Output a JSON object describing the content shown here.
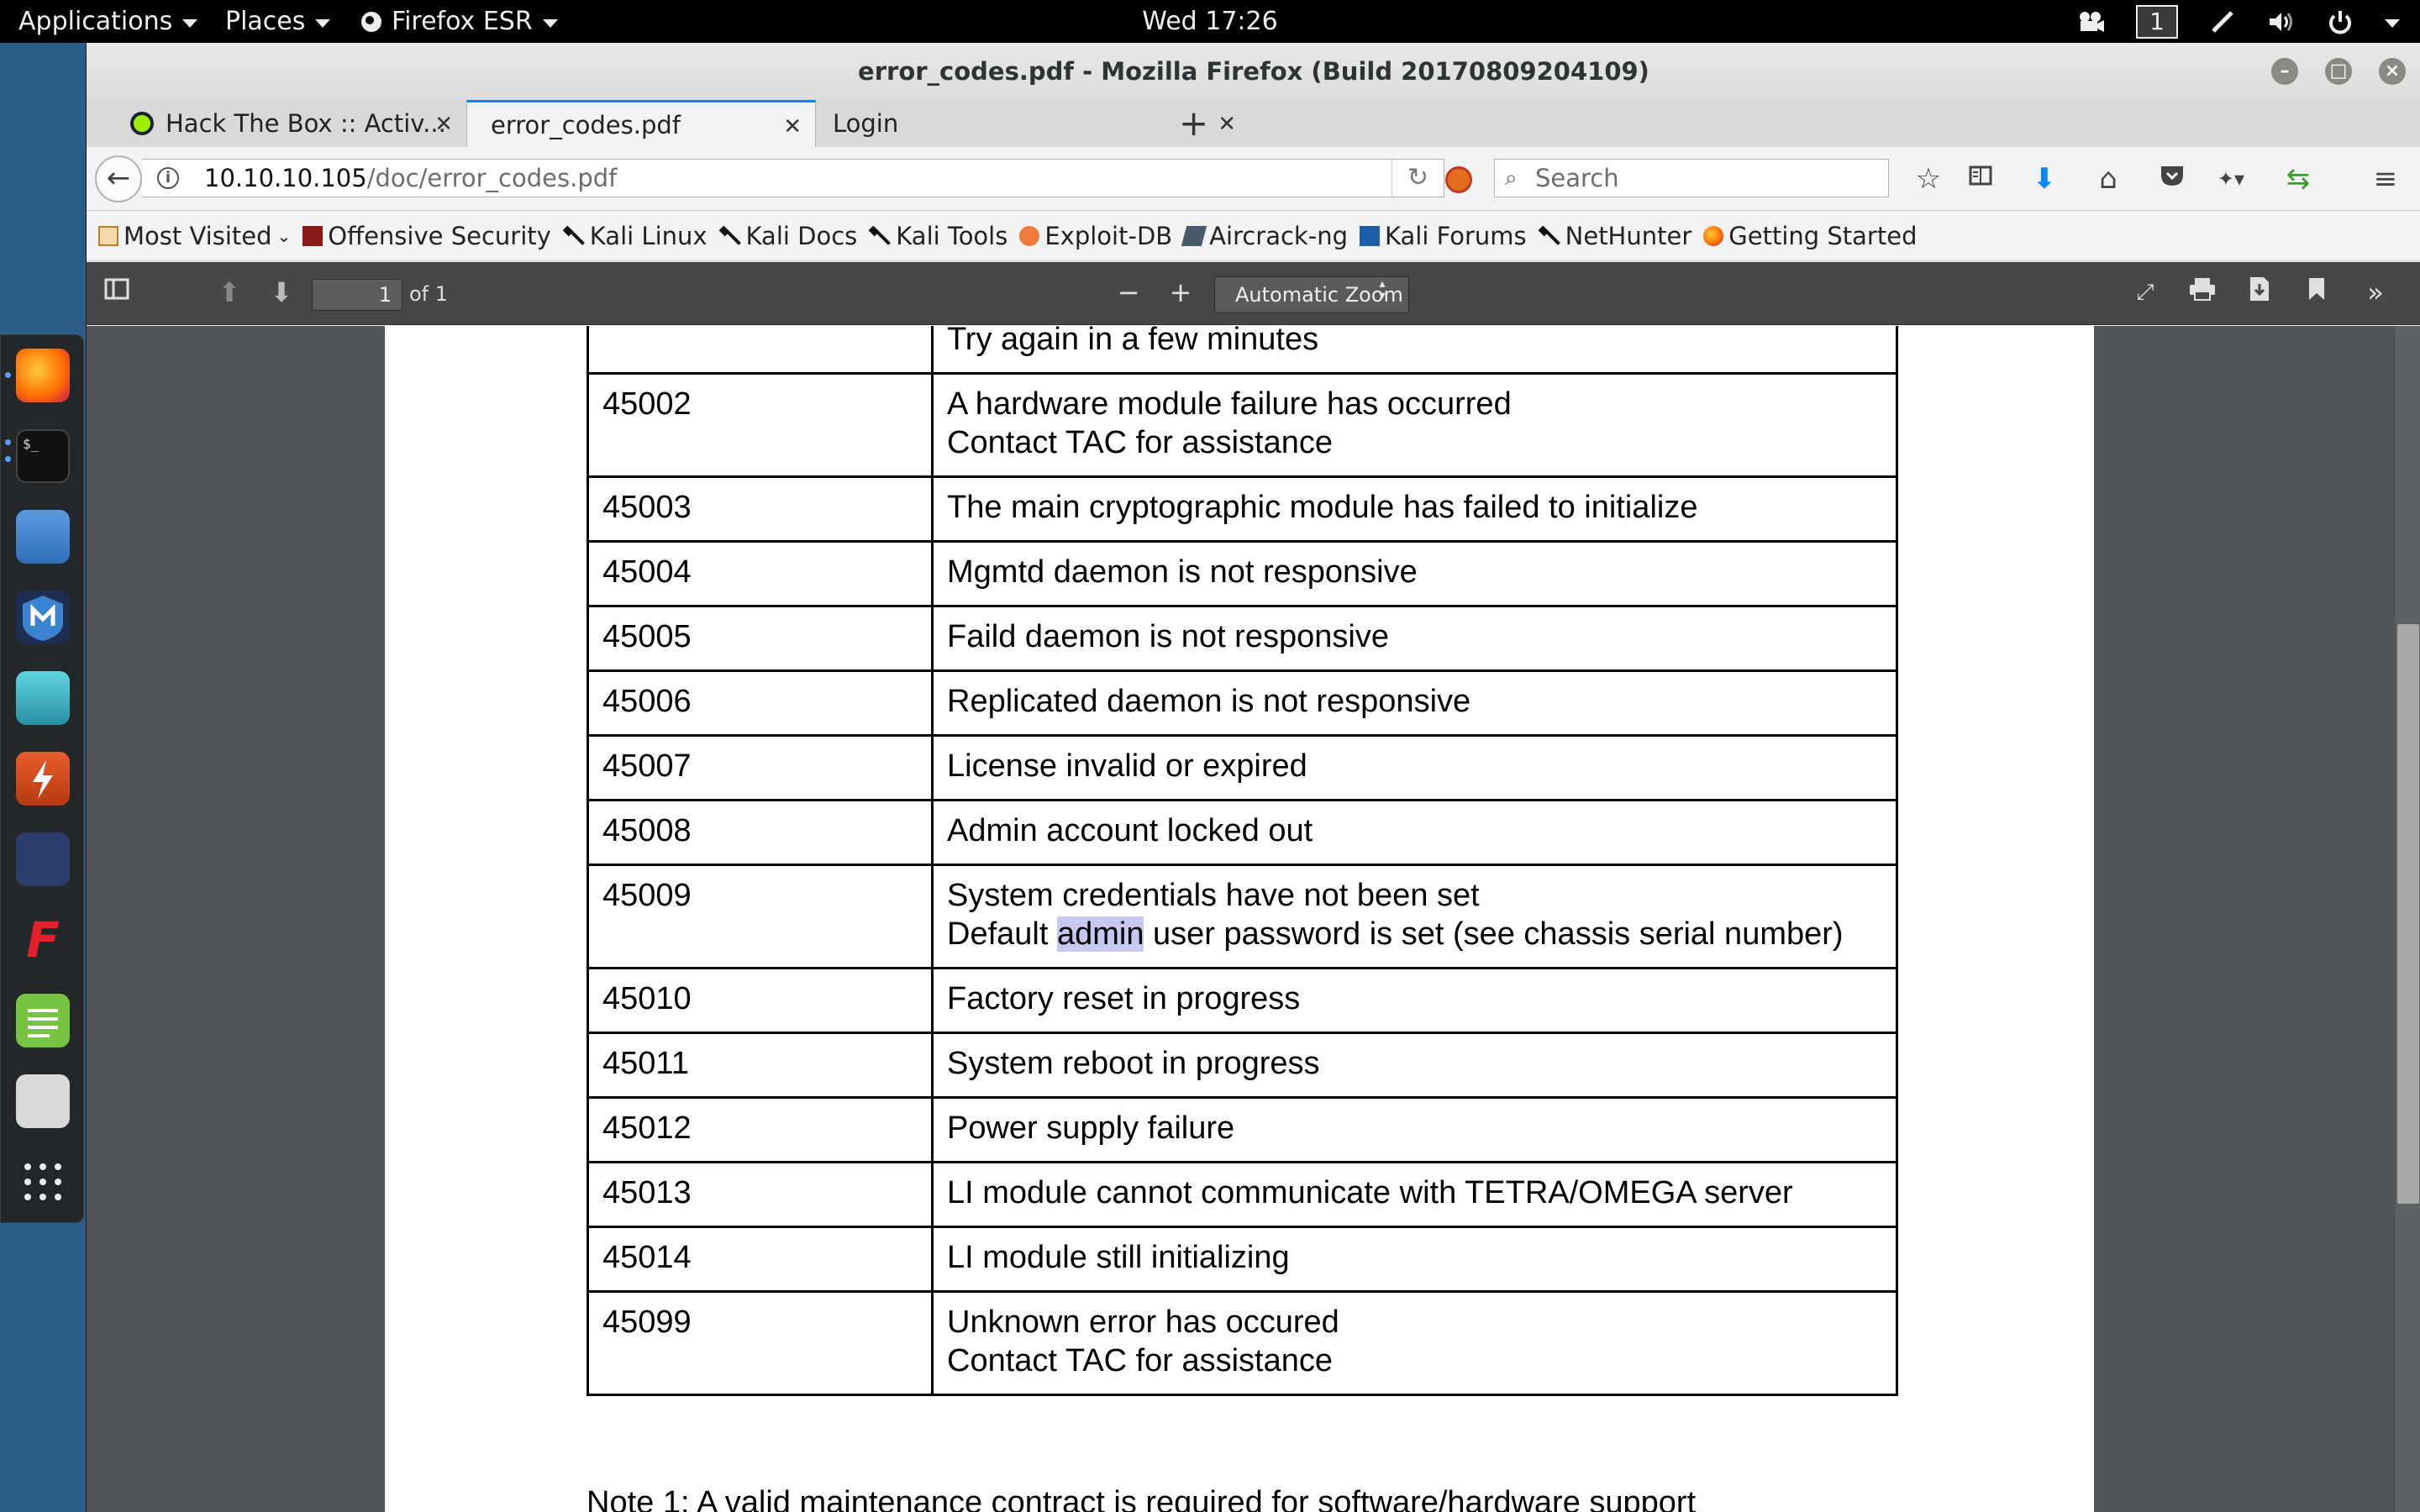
{
  "topbar": {
    "applications": "Applications",
    "places": "Places",
    "firefox": "Firefox ESR",
    "clock": "Wed 17:26",
    "workspace": "1"
  },
  "window": {
    "title": "error_codes.pdf - Mozilla Firefox (Build 20170809204109)"
  },
  "tabs": [
    {
      "label": "Hack The Box :: Activ..."
    },
    {
      "label": "error_codes.pdf"
    },
    {
      "label": "Login"
    }
  ],
  "nav": {
    "url_host": "10.10.10.105",
    "url_path": "/doc/error_codes.pdf",
    "search_placeholder": "Search"
  },
  "bookmarks": [
    {
      "label": "Most Visited",
      "icon": "most-visited-icon"
    },
    {
      "label": "Offensive Security",
      "icon": "offsec-icon"
    },
    {
      "label": "Kali Linux",
      "icon": "kali-dragon-icon"
    },
    {
      "label": "Kali Docs",
      "icon": "kali-dragon-icon"
    },
    {
      "label": "Kali Tools",
      "icon": "kali-dragon-icon"
    },
    {
      "label": "Exploit-DB",
      "icon": "exploitdb-icon"
    },
    {
      "label": "Aircrack-ng",
      "icon": "aircrack-icon"
    },
    {
      "label": "Kali Forums",
      "icon": "kali-forums-icon"
    },
    {
      "label": "NetHunter",
      "icon": "kali-dragon-icon"
    },
    {
      "label": "Getting Started",
      "icon": "firefox-icon"
    }
  ],
  "pdf": {
    "page_number": "1",
    "page_count": "of 1",
    "zoom": "Automatic Zoom",
    "rows": [
      {
        "code": "",
        "lines": [
          "Try again in a few minutes"
        ]
      },
      {
        "code": "45002",
        "lines": [
          "A hardware module failure has occurred",
          "Contact TAC for assistance"
        ]
      },
      {
        "code": "45003",
        "lines": [
          "The main cryptographic module has failed to initialize"
        ]
      },
      {
        "code": "45004",
        "lines": [
          "Mgmtd daemon is not responsive"
        ]
      },
      {
        "code": "45005",
        "lines": [
          "Faild daemon is not responsive"
        ]
      },
      {
        "code": "45006",
        "lines": [
          "Replicated daemon is not responsive"
        ]
      },
      {
        "code": "45007",
        "lines": [
          "License invalid or expired"
        ]
      },
      {
        "code": "45008",
        "lines": [
          "Admin account locked out"
        ]
      },
      {
        "code": "45009",
        "lines": [
          "System credentials have not been set",
          "Default admin user password is set (see chassis serial number)"
        ]
      },
      {
        "code": "45010",
        "lines": [
          "Factory reset in progress"
        ]
      },
      {
        "code": "45011",
        "lines": [
          "System reboot in progress"
        ]
      },
      {
        "code": "45012",
        "lines": [
          "Power supply failure"
        ]
      },
      {
        "code": "45013",
        "lines": [
          "LI module cannot communicate with TETRA/OMEGA server"
        ]
      },
      {
        "code": "45014",
        "lines": [
          "LI module still initializing"
        ]
      },
      {
        "code": "45099",
        "lines": [
          "Unknown error has occured",
          "Contact TAC for assistance"
        ]
      }
    ],
    "highlighted_word": "admin",
    "note_partial": "Note 1: A valid maintenance contract is required for software/hardware support"
  },
  "colors": {
    "accent": "#0a84ff",
    "highlight": "#c6c8f0",
    "pdf_toolbar": "#474747",
    "viewer_bg": "#525659"
  }
}
